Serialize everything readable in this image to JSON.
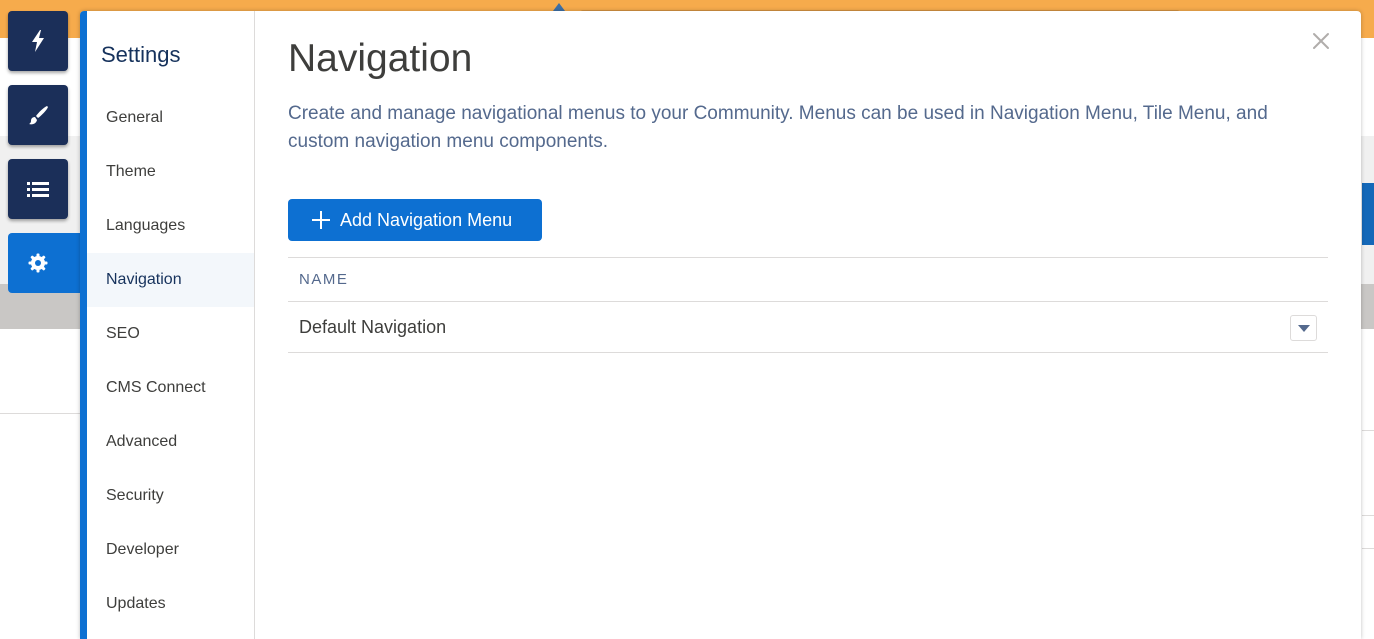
{
  "settings": {
    "title": "Settings",
    "items": [
      {
        "label": "General"
      },
      {
        "label": "Theme"
      },
      {
        "label": "Languages"
      },
      {
        "label": "Navigation"
      },
      {
        "label": "SEO"
      },
      {
        "label": "CMS Connect"
      },
      {
        "label": "Advanced"
      },
      {
        "label": "Security"
      },
      {
        "label": "Developer"
      },
      {
        "label": "Updates"
      }
    ],
    "selected": "Navigation"
  },
  "rail": [
    {
      "icon": "lightning-icon"
    },
    {
      "icon": "brush-icon"
    },
    {
      "icon": "list-icon"
    },
    {
      "icon": "gear-icon",
      "active": true
    }
  ],
  "main": {
    "title": "Navigation",
    "description": "Create and manage navigational menus to your Community. Menus can be used in Navigation Menu, Tile Menu, and custom navigation menu components.",
    "add_button_label": "Add Navigation Menu",
    "table": {
      "header": "NAME",
      "rows": [
        {
          "name": "Default Navigation"
        }
      ]
    }
  },
  "colors": {
    "brand": "#0d70d2",
    "rail_dark": "#1b2f59",
    "banner": "#f6ab4c"
  }
}
